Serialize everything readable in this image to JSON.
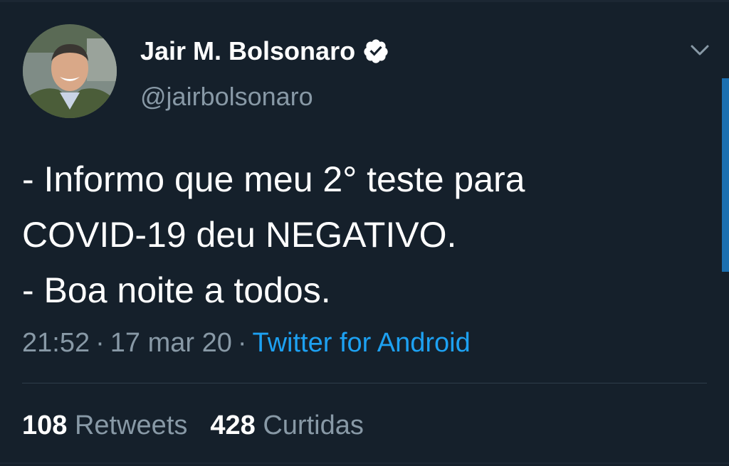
{
  "tweet": {
    "display_name": "Jair M. Bolsonaro",
    "handle": "@jairbolsonaro",
    "verified_icon": "verified-badge-icon",
    "menu_icon": "chevron-down-icon",
    "text": "- Informo que meu 2° teste para\nCOVID-19 deu NEGATIVO.\n- Boa noite a todos.",
    "time": "21:52",
    "date": "17 mar 20",
    "separator": "·",
    "source": "Twitter for Android"
  },
  "stats": {
    "retweets_count": "108",
    "retweets_label": "Retweets",
    "likes_count": "428",
    "likes_label": "Curtidas"
  },
  "colors": {
    "background": "#15202b",
    "secondary_text": "#8899a6",
    "link": "#1da1f2"
  }
}
